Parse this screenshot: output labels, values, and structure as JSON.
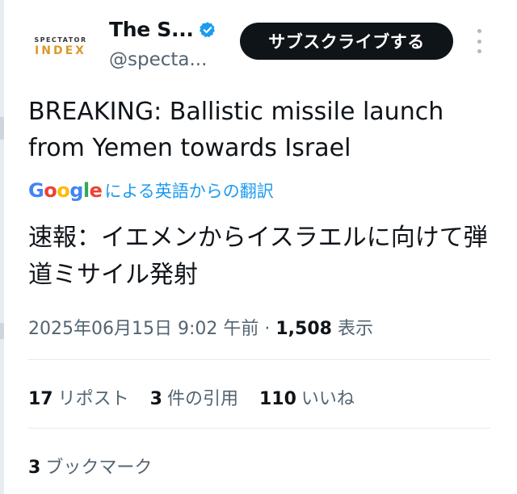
{
  "account": {
    "avatar_line1": "SPECTATOR",
    "avatar_line2": "INDEX",
    "name": "The S...",
    "handle": "@specta...",
    "verified_icon": "verified-badge-icon",
    "verified_color": "#1d9bf0"
  },
  "actions": {
    "subscribe_label": "サブスクライブする",
    "more_icon": "more-vertical-icon"
  },
  "tweet": {
    "text_en": "BREAKING: Ballistic missile launch from Yemen towards Israel",
    "translation_label": "による英語からの翻訳",
    "translation_provider": "Google",
    "text_ja": "速報：イエメンからイスラエルに向けて弾道ミサイル発射"
  },
  "meta": {
    "timestamp": "2025年06月15日 9:02 午前",
    "separator": "·",
    "views_count": "1,508",
    "views_label": "表示"
  },
  "stats": {
    "reposts_count": "17",
    "reposts_label": "リポスト",
    "quotes_count": "3",
    "quotes_label": "件の引用",
    "likes_count": "110",
    "likes_label": "いいね",
    "bookmarks_count": "3",
    "bookmarks_label": "ブックマーク"
  },
  "colors": {
    "accent": "#1d9bf0",
    "text_primary": "#0f1419",
    "text_secondary": "#536471",
    "button_bg": "#0f1419",
    "avatar_index": "#d99a2b"
  }
}
